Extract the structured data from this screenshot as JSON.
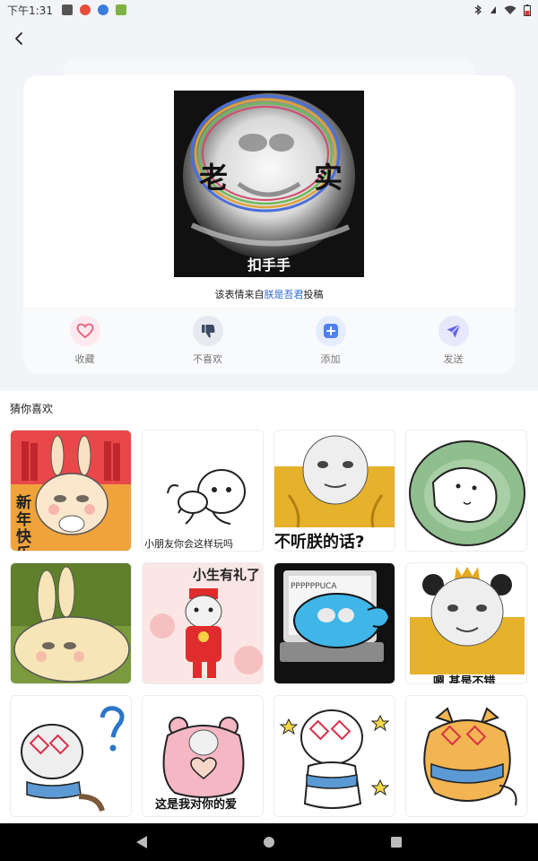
{
  "status_bar": {
    "time": "下午1:31"
  },
  "preview": {
    "top_text_left": "老",
    "top_text_right": "实",
    "bottom_text": "扣手手"
  },
  "source": {
    "prefix": "该表情来自",
    "author": "朕是吾君",
    "suffix": "投稿"
  },
  "actions": [
    {
      "label": "收藏",
      "icon": "heart-icon",
      "color": "#e85a78",
      "bg": "#fde9ee"
    },
    {
      "label": "不喜欢",
      "icon": "thumbs-down-icon",
      "color": "#3e4a66",
      "bg": "#e6e9f0"
    },
    {
      "label": "添加",
      "icon": "plus-icon",
      "color": "#4f7ff0",
      "bg": "#e4ecfd"
    },
    {
      "label": "发送",
      "icon": "send-icon",
      "color": "#6366f1",
      "bg": "#e8e8fc"
    }
  ],
  "recommend": {
    "title": "猜你喜欢",
    "tiles": [
      {
        "caption": "新年快乐",
        "name": "sticker-rabbit-new-year"
      },
      {
        "caption": "小朋友你会这样玩吗",
        "name": "sticker-kid-play"
      },
      {
        "caption": "不听朕的话?",
        "name": "sticker-emperor-angry"
      },
      {
        "caption": "",
        "name": "sticker-lying-green"
      },
      {
        "caption": "",
        "name": "sticker-rabbit-lying"
      },
      {
        "caption": "小生有礼了",
        "name": "sticker-greeting"
      },
      {
        "caption": "",
        "name": "sticker-laptop-blue"
      },
      {
        "caption": "嗯 甚是不错",
        "name": "sticker-panda-crown"
      },
      {
        "caption": "",
        "name": "sticker-question-cat"
      },
      {
        "caption": "这是我对你的爱",
        "name": "sticker-pink-love"
      },
      {
        "caption": "",
        "name": "sticker-white-dog"
      },
      {
        "caption": "",
        "name": "sticker-orange-cat"
      }
    ]
  }
}
